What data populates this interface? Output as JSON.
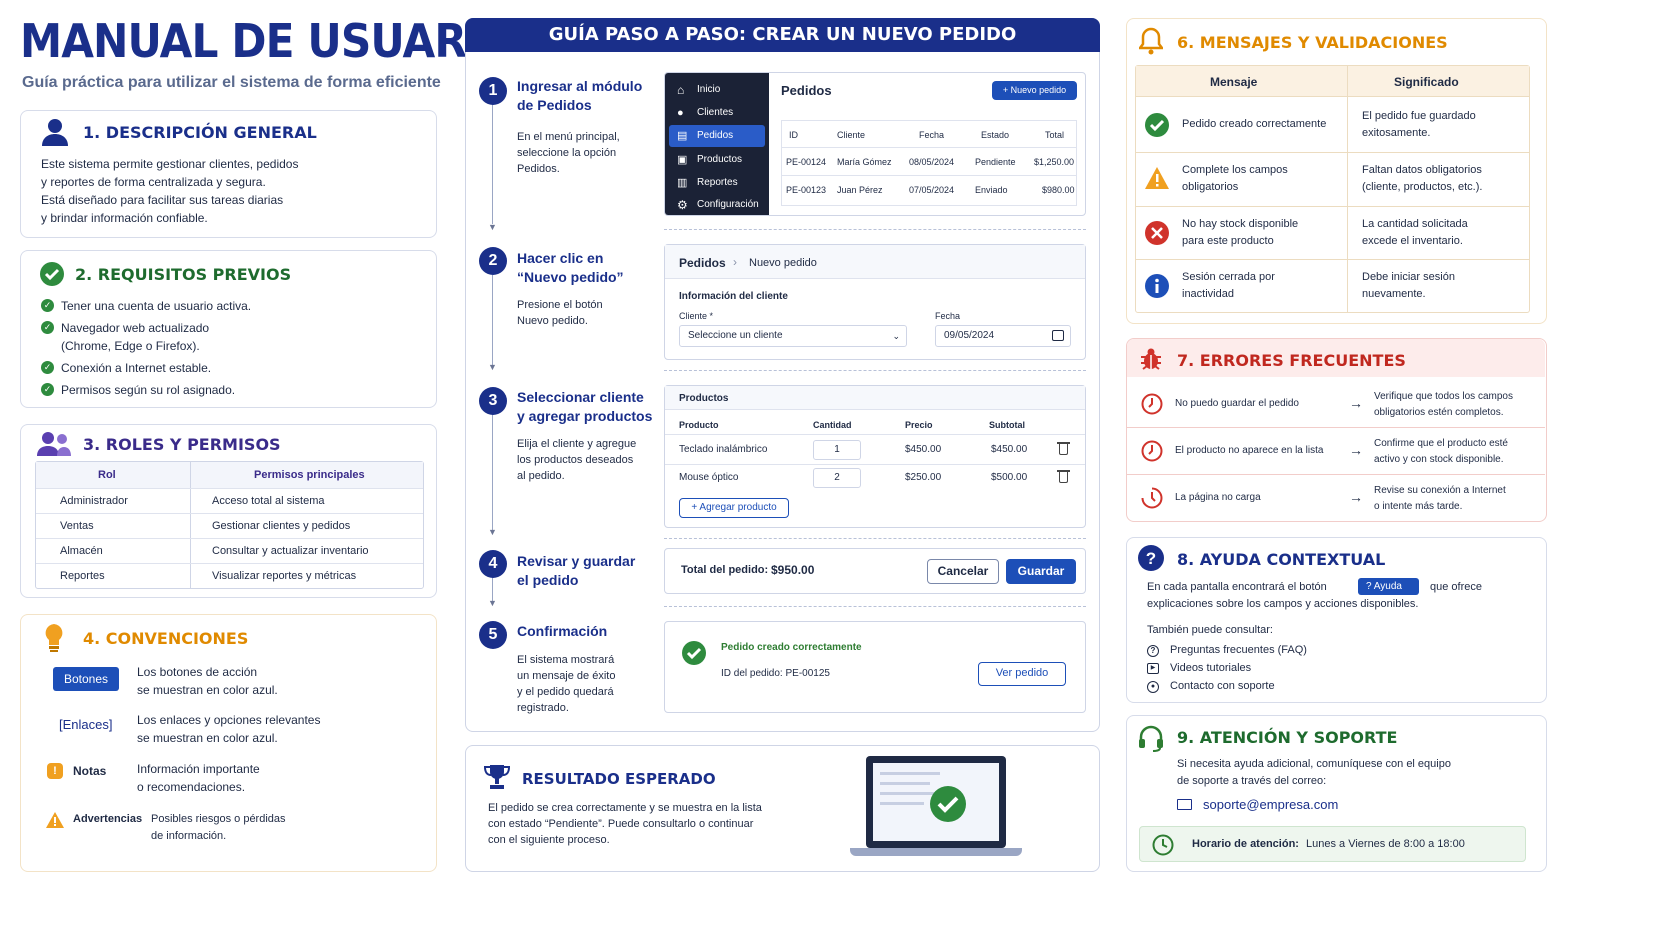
{
  "header": {
    "title": "MANUAL DE USUARIO",
    "subtitle": "Guía práctica para utilizar el sistema de forma eficiente"
  },
  "sec1": {
    "title": "1. DESCRIPCIÓN GENERAL",
    "lines": [
      "Este sistema permite gestionar clientes, pedidos",
      "y reportes de forma centralizada y segura.",
      "Está diseñado para facilitar sus tareas diarias",
      "y brindar información confiable."
    ]
  },
  "sec2": {
    "title": "2. REQUISITOS PREVIOS",
    "items": [
      "Tener una cuenta de usuario activa.",
      "Navegador web actualizado",
      "(Chrome, Edge o Firefox).",
      "Conexión a Internet estable.",
      "Permisos según su rol asignado."
    ]
  },
  "sec3": {
    "title": "3. ROLES Y PERMISOS",
    "headers": [
      "Rol",
      "Permisos principales"
    ],
    "rows": [
      [
        "Administrador",
        "Acceso total al sistema"
      ],
      [
        "Ventas",
        "Gestionar clientes y pedidos"
      ],
      [
        "Almacén",
        "Consultar y actualizar inventario"
      ],
      [
        "Reportes",
        "Visualizar reportes y métricas"
      ]
    ]
  },
  "sec4": {
    "title": "4. CONVENCIONES",
    "buttons_label": "Botones",
    "buttons_desc": [
      "Los botones de acción",
      "se muestran en color azul."
    ],
    "links_label": "[Enlaces]",
    "links_desc": [
      "Los enlaces y opciones relevantes",
      "se muestran en color azul."
    ],
    "notes_label": "Notas",
    "notes_desc": [
      "Información importante",
      "o recomendaciones."
    ],
    "warn_label": "Advertencias",
    "warn_desc": [
      "Posibles riesgos o pérdidas",
      "de información."
    ]
  },
  "guide": {
    "title": "GUÍA PASO A PASO: CREAR UN NUEVO PEDIDO",
    "steps": [
      {
        "num": "1",
        "title": [
          "Ingresar al módulo",
          "de Pedidos"
        ],
        "desc": [
          "En el menú principal,",
          "seleccione la opción",
          "Pedidos."
        ]
      },
      {
        "num": "2",
        "title": [
          "Hacer clic en",
          "“Nuevo pedido”"
        ],
        "desc": [
          "Presione el botón",
          "Nuevo pedido."
        ]
      },
      {
        "num": "3",
        "title": [
          "Seleccionar cliente",
          "y agregar productos"
        ],
        "desc": [
          "Elija el cliente y agregue",
          "los productos deseados",
          "al pedido."
        ]
      },
      {
        "num": "4",
        "title": [
          "Revisar y guardar",
          "el pedido"
        ],
        "desc": []
      },
      {
        "num": "5",
        "title": [
          "Confirmación"
        ],
        "desc": [
          "El sistema mostrará",
          "un mensaje de éxito",
          "y el pedido quedará",
          "registrado."
        ]
      }
    ],
    "menu": [
      "Inicio",
      "Clientes",
      "Pedidos",
      "Productos",
      "Reportes",
      "Configuración"
    ],
    "orders_title": "Pedidos",
    "new_order_btn": "+ Nuevo pedido",
    "orders_headers": [
      "ID",
      "Cliente",
      "Fecha",
      "Estado",
      "Total"
    ],
    "orders_rows": [
      [
        "PE-00124",
        "María Gómez",
        "08/05/2024",
        "Pendiente",
        "$1,250.00"
      ],
      [
        "PE-00123",
        "Juan Pérez",
        "07/05/2024",
        "Enviado",
        "$980.00"
      ]
    ],
    "bc_root": "Pedidos",
    "bc_sep": "›",
    "bc_leaf": "Nuevo pedido",
    "client_info": "Información del cliente",
    "client_label": "Cliente *",
    "client_placeholder": "Seleccione un cliente",
    "date_label": "Fecha",
    "date_value": "09/05/2024",
    "products_title": "Productos",
    "prod_headers": [
      "Producto",
      "Cantidad",
      "Precio",
      "Subtotal"
    ],
    "prod_rows": [
      [
        "Teclado inalámbrico",
        "1",
        "$450.00",
        "$450.00"
      ],
      [
        "Mouse óptico",
        "2",
        "$250.00",
        "$500.00"
      ]
    ],
    "add_product": "+ Agregar producto",
    "total_label": "Total del pedido:",
    "total_value": "$950.00",
    "cancel": "Cancelar",
    "save": "Guardar",
    "success_msg": "Pedido creado correctamente",
    "order_id": "ID del pedido: PE-00125",
    "view_order": "Ver pedido"
  },
  "result": {
    "title": "RESULTADO ESPERADO",
    "lines": [
      "El pedido se crea correctamente y se muestra en la lista",
      "con estado “Pendiente”. Puede consultarlo o continuar",
      "con el siguiente proceso."
    ]
  },
  "sec6": {
    "title": "6. MENSAJES Y VALIDACIONES",
    "headers": [
      "Mensaje",
      "Significado"
    ],
    "rows": [
      {
        "icon": "check",
        "msg": [
          "Pedido creado correctamente"
        ],
        "mean": [
          "El pedido fue guardado",
          "exitosamente."
        ]
      },
      {
        "icon": "warn",
        "msg": [
          "Complete los campos",
          "obligatorios"
        ],
        "mean": [
          "Faltan datos obligatorios",
          "(cliente, productos, etc.)."
        ]
      },
      {
        "icon": "error",
        "msg": [
          "No hay stock disponible",
          "para este producto"
        ],
        "mean": [
          "La cantidad solicitada",
          "excede el inventario."
        ]
      },
      {
        "icon": "info",
        "msg": [
          "Sesión cerrada por",
          "inactividad"
        ],
        "mean": [
          "Debe iniciar sesión",
          "nuevamente."
        ]
      }
    ]
  },
  "sec7": {
    "title": "7. ERRORES FRECUENTES",
    "rows": [
      {
        "problem": "No puedo guardar el pedido",
        "fix": [
          "Verifique que todos los campos",
          "obligatorios estén completos."
        ]
      },
      {
        "problem": "El producto no aparece en la lista",
        "fix": [
          "Confirme que el producto esté",
          "activo y con stock disponible."
        ]
      },
      {
        "problem": "La página no carga",
        "fix": [
          "Revise su conexión a Internet",
          "o intente más tarde."
        ]
      }
    ]
  },
  "sec8": {
    "title": "8. AYUDA CONTEXTUAL",
    "line1a": "En cada pantalla encontrará el botón",
    "help_btn": "Ayuda",
    "line1b": "que ofrece",
    "line2": "explicaciones sobre los campos y acciones disponibles.",
    "also": "También puede consultar:",
    "links": [
      "Preguntas frecuentes (FAQ)",
      "Videos tutoriales",
      "Contacto con soporte"
    ]
  },
  "sec9": {
    "title": "9. ATENCIÓN Y SOPORTE",
    "lines": [
      "Si necesita ayuda adicional, comuníquese con el equipo",
      "de soporte a través del correo:"
    ],
    "email": "soporte@empresa.com",
    "hours_label": "Horario de atención:",
    "hours_value": "Lunes a Viernes de 8:00 a 18:00"
  },
  "colors": {
    "navy": "#1a2f8a",
    "blue": "#1d4fb8",
    "green": "#2e8b3e",
    "orange": "#e08a00",
    "red": "#d0332b"
  }
}
